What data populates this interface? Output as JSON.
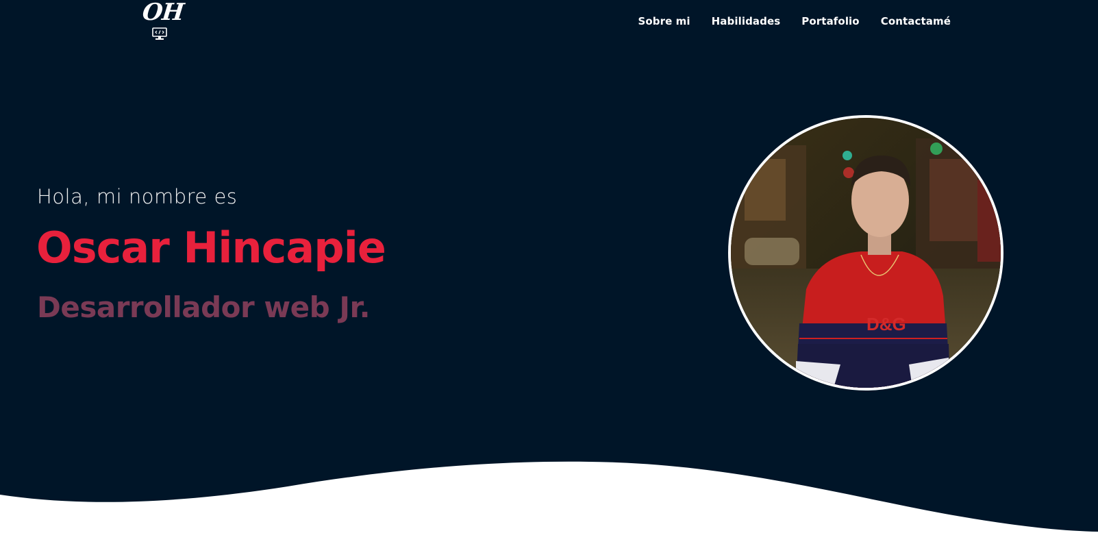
{
  "header": {
    "logo_text": "OH",
    "nav": [
      {
        "label": "Sobre mi"
      },
      {
        "label": "Habilidades"
      },
      {
        "label": "Portafolio"
      },
      {
        "label": "Contactamé"
      }
    ]
  },
  "hero": {
    "greeting": "Hola, mi nombre es",
    "name": "Oscar Hincapie",
    "role": "Desarrollador web Jr."
  },
  "photo": {
    "shirt_text": "D&G"
  },
  "colors": {
    "background": "#001528",
    "accent": "#e8213c",
    "role": "#7a3a55",
    "wave": "#ffffff"
  }
}
